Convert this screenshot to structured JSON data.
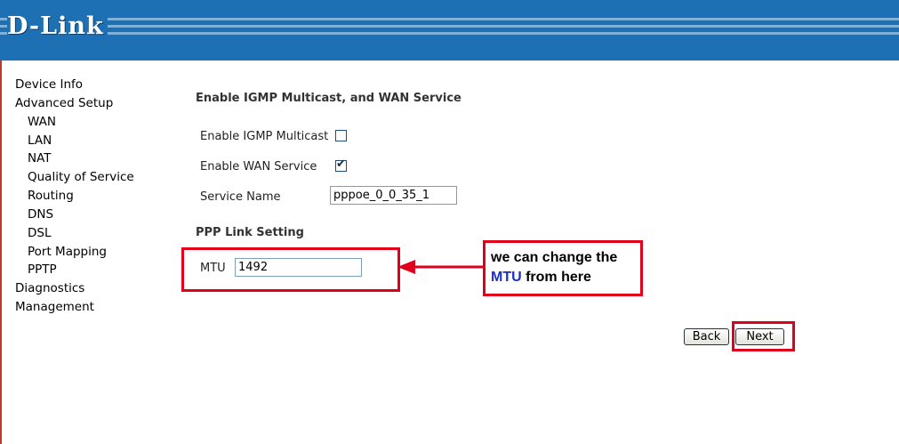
{
  "brand": {
    "logo_text": "D-Link"
  },
  "sidebar": {
    "items": [
      {
        "label": "Device Info",
        "level": 0
      },
      {
        "label": "Advanced Setup",
        "level": 0
      },
      {
        "label": "WAN",
        "level": 1
      },
      {
        "label": "LAN",
        "level": 1
      },
      {
        "label": "NAT",
        "level": 1
      },
      {
        "label": "Quality of Service",
        "level": 1
      },
      {
        "label": "Routing",
        "level": 1
      },
      {
        "label": "DNS",
        "level": 1
      },
      {
        "label": "DSL",
        "level": 1
      },
      {
        "label": "Port Mapping",
        "level": 1
      },
      {
        "label": "PPTP",
        "level": 1
      },
      {
        "label": "Diagnostics",
        "level": 0
      },
      {
        "label": "Management",
        "level": 0
      }
    ]
  },
  "main": {
    "section_title": "Enable IGMP Multicast, and WAN Service",
    "igmp": {
      "label": "Enable IGMP Multicast",
      "checked": false
    },
    "wan_service": {
      "label": "Enable WAN Service",
      "checked": true
    },
    "service_name": {
      "label": "Service Name",
      "value": "pppoe_0_0_35_1"
    },
    "ppp_title": "PPP Link Setting",
    "mtu": {
      "label": "MTU",
      "value": "1492"
    },
    "back_label": "Back",
    "next_label": "Next"
  },
  "annotation": {
    "line1": "we can change the",
    "mtu_word": "MTU",
    "line2_rest": " from here",
    "color": "#e0001b"
  }
}
